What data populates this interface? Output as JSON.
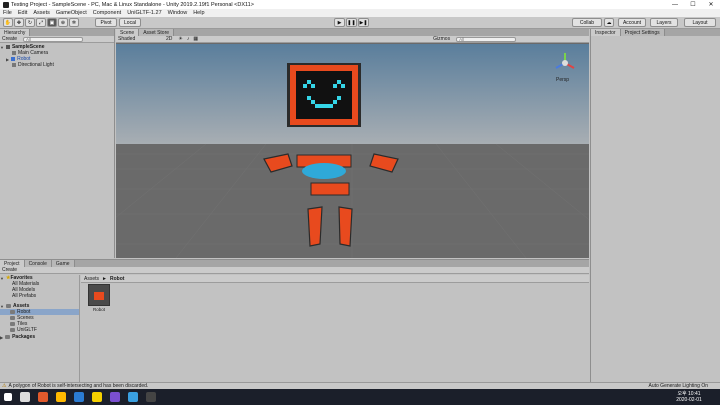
{
  "window": {
    "title": "Testing Project - SampleScene - PC, Mac & Linux Standalone - Unity 2019.2.19f1 Personal <DX11>"
  },
  "menu": [
    "File",
    "Edit",
    "Assets",
    "GameObject",
    "Component",
    "UniGLTF-1.27",
    "Window",
    "Help"
  ],
  "toolbar": {
    "pivot": "Pivot",
    "local": "Local",
    "collab": "Collab",
    "account": "Account",
    "layers": "Layers",
    "layout": "Layout"
  },
  "hierarchy": {
    "tab": "Hierarchy",
    "create": "Create",
    "search_placeholder": "All",
    "scene": "SampleScene",
    "items": [
      "Main Camera",
      "Robot",
      "Directional Light"
    ]
  },
  "scene_view": {
    "tabs": [
      "Scene",
      "Asset Store"
    ],
    "shading": "Shaded",
    "mode": "2D",
    "gizmos": "Gizmos",
    "search_placeholder": "All",
    "persp": "Persp"
  },
  "inspector": {
    "tabs": [
      "Inspector",
      "Project Settings"
    ]
  },
  "project": {
    "tabs": [
      "Project",
      "Console",
      "Game"
    ],
    "create": "Create",
    "favorites": "Favorites",
    "favorite_items": [
      "All Materials",
      "All Models",
      "All Prefabs"
    ],
    "assets": "Assets",
    "asset_folders": [
      "Robot",
      "Scenes",
      "Tiles",
      "UniGLTF"
    ],
    "packages": "Packages",
    "breadcrumb": [
      "Assets",
      "Robot"
    ],
    "selected_asset": "Robot"
  },
  "status": {
    "message": "A polygon of Robot is self-intersecting and has been discarded.",
    "lighting": "Auto Generate Lighting On"
  },
  "clock": {
    "time": "오후 10:41",
    "date": "2020-02-01"
  },
  "colors": {
    "robot_orange": "#e84a1e",
    "robot_blue": "#2fa9d9",
    "face_cyan": "#35d6e8",
    "sky_top": "#5a7e9c",
    "ground": "#6a6a6a"
  }
}
